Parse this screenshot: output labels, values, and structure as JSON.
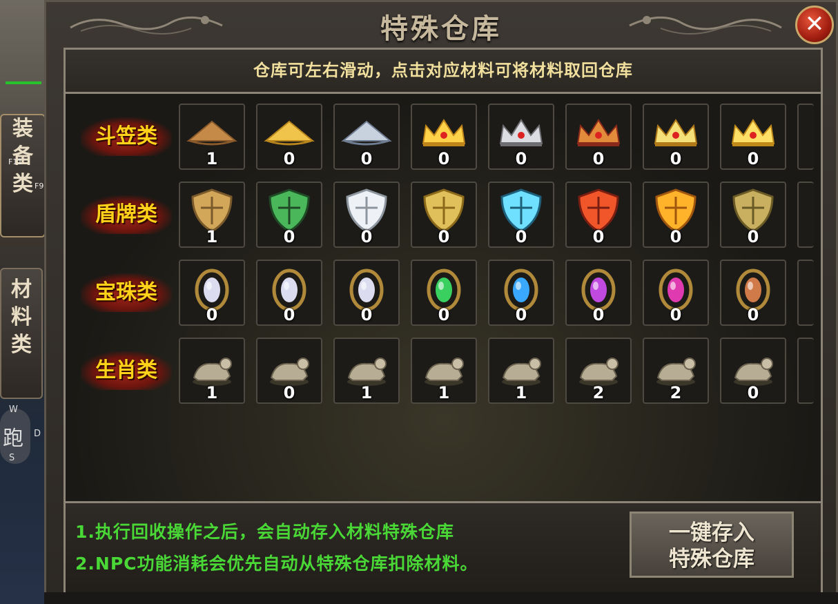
{
  "window": {
    "title": "特殊仓库",
    "close_label": "✕"
  },
  "notice": "仓库可左右滑动，点击对应材料可将材料取回仓库",
  "rows": [
    {
      "label": "斗笠类",
      "items": [
        {
          "icon": "straw-hat-brown-icon",
          "count": "1"
        },
        {
          "icon": "straw-hat-gold-icon",
          "count": "0"
        },
        {
          "icon": "straw-hat-silver-icon",
          "count": "0"
        },
        {
          "icon": "gold-crown-icon",
          "count": "0"
        },
        {
          "icon": "silver-crown-icon",
          "count": "0"
        },
        {
          "icon": "jeweled-crown-red-icon",
          "count": "0"
        },
        {
          "icon": "jeweled-crown-gold-icon",
          "count": "0"
        },
        {
          "icon": "gold-crown-red-gem-icon",
          "count": "0"
        }
      ]
    },
    {
      "label": "盾牌类",
      "items": [
        {
          "icon": "bat-wing-shield-icon",
          "count": "1"
        },
        {
          "icon": "jade-dragon-shield-icon",
          "count": "0"
        },
        {
          "icon": "silver-cross-shield-icon",
          "count": "0"
        },
        {
          "icon": "gold-round-shield-icon",
          "count": "0"
        },
        {
          "icon": "ice-crystal-shield-icon",
          "count": "0"
        },
        {
          "icon": "flame-shield-icon",
          "count": "0"
        },
        {
          "icon": "golden-flame-shield-icon",
          "count": "0"
        },
        {
          "icon": "emerald-crest-shield-icon",
          "count": "0"
        }
      ]
    },
    {
      "label": "宝珠类",
      "items": [
        {
          "icon": "silver-orb-icon",
          "count": "0"
        },
        {
          "icon": "silver-orb-icon",
          "count": "0"
        },
        {
          "icon": "silver-orb-icon",
          "count": "0"
        },
        {
          "icon": "green-orb-icon",
          "count": "0"
        },
        {
          "icon": "blue-orb-icon",
          "count": "0"
        },
        {
          "icon": "violet-orb-icon",
          "count": "0"
        },
        {
          "icon": "magenta-orb-icon",
          "count": "0"
        },
        {
          "icon": "bronze-orb-icon",
          "count": "0"
        }
      ]
    },
    {
      "label": "生肖类",
      "items": [
        {
          "icon": "rat-statue-icon",
          "count": "1"
        },
        {
          "icon": "ox-statue-icon",
          "count": "0"
        },
        {
          "icon": "tiger-statue-icon",
          "count": "1"
        },
        {
          "icon": "rabbit-statue-icon",
          "count": "1"
        },
        {
          "icon": "dragon-statue-icon",
          "count": "1"
        },
        {
          "icon": "snake-statue-icon",
          "count": "2"
        },
        {
          "icon": "horse-statue-icon",
          "count": "2"
        },
        {
          "icon": "goat-statue-icon",
          "count": "0"
        }
      ]
    }
  ],
  "tips": [
    "1.执行回收操作之后，会自动存入材料特殊仓库",
    "2.NPC功能消耗会优先自动从特殊仓库扣除材料。"
  ],
  "store_button": {
    "line1": "一键存入",
    "line2": "特殊仓库"
  },
  "sidebar": {
    "tab_equip": "装\n备\n类",
    "tab_material": "材\n料\n类",
    "f11": "F11",
    "f9": "F9",
    "run": "跑",
    "w": "W",
    "s": "S",
    "d": "D"
  },
  "colors": {
    "label_text": "#ffd21a",
    "label_bg": "#a32519",
    "tip_green": "#49d836",
    "notice_text": "#f1df9e",
    "close_red": "#c0301f"
  }
}
